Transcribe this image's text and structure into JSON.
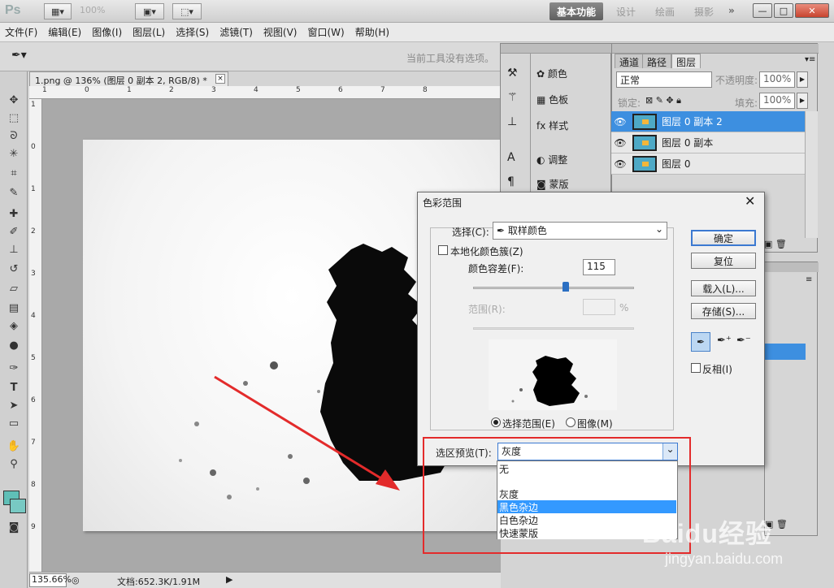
{
  "app": {
    "logo": "Ps",
    "zoom": "100%",
    "workspace_active": "基本功能",
    "workspaces": [
      "设计",
      "绘画",
      "摄影"
    ],
    "more": "»"
  },
  "menu": [
    "文件(F)",
    "编辑(E)",
    "图像(I)",
    "图层(L)",
    "选择(S)",
    "滤镜(T)",
    "视图(V)",
    "窗口(W)",
    "帮助(H)"
  ],
  "options": {
    "hint": "当前工具没有选项。"
  },
  "document": {
    "tab": "1.png @ 136% (图层 0 副本 2, RGB/8) *",
    "close": "×"
  },
  "rulers": {
    "top": [
      "1",
      "0",
      "1",
      "2",
      "3",
      "4",
      "5",
      "6",
      "7",
      "8"
    ],
    "left": [
      "1",
      "0",
      "1",
      "2",
      "3",
      "4",
      "5",
      "6",
      "7",
      "8",
      "9"
    ]
  },
  "status": {
    "zoom": "135.66%",
    "doc": "文档:652.3K/1.91M"
  },
  "mini_panel": {
    "items_right": [
      "颜色",
      "色板",
      "样式",
      "调整",
      "蒙版"
    ]
  },
  "layers_panel": {
    "tabs": [
      "通道",
      "路径",
      "图层"
    ],
    "blend": "正常",
    "opacity_label": "不透明度:",
    "opacity": "100%",
    "lock_label": "锁定:",
    "fill_label": "填充:",
    "fill": "100%",
    "layers": [
      "图层 0 副本 2",
      "图层 0 副本",
      "图层 0"
    ],
    "selected_index": 0
  },
  "dialog": {
    "title": "色彩范围",
    "select_label": "选择(C):",
    "select_value": "取样颜色",
    "localized": "本地化颜色簇(Z)",
    "fuzziness_label": "颜色容差(F):",
    "fuzziness": "115",
    "range_label": "范围(R):",
    "range_unit": "%",
    "radio_selection": "选择范围(E)",
    "radio_image": "图像(M)",
    "ok": "确定",
    "reset": "复位",
    "load": "载入(L)...",
    "save": "存储(S)...",
    "invert": "反相(I)",
    "preview_label": "选区预览(T):",
    "preview_value": "灰度",
    "preview_options": [
      "无",
      "灰度",
      "黑色杂边",
      "白色杂边",
      "快速蒙版"
    ],
    "highlighted_option": "黑色杂边"
  },
  "watermark": {
    "line1": "Baidu经验",
    "line2": "jingyan.baidu.com"
  },
  "colors": {
    "accent": "#3399ff",
    "selected_layer": "#3d8fe0",
    "arrow": "#e32b2b"
  }
}
